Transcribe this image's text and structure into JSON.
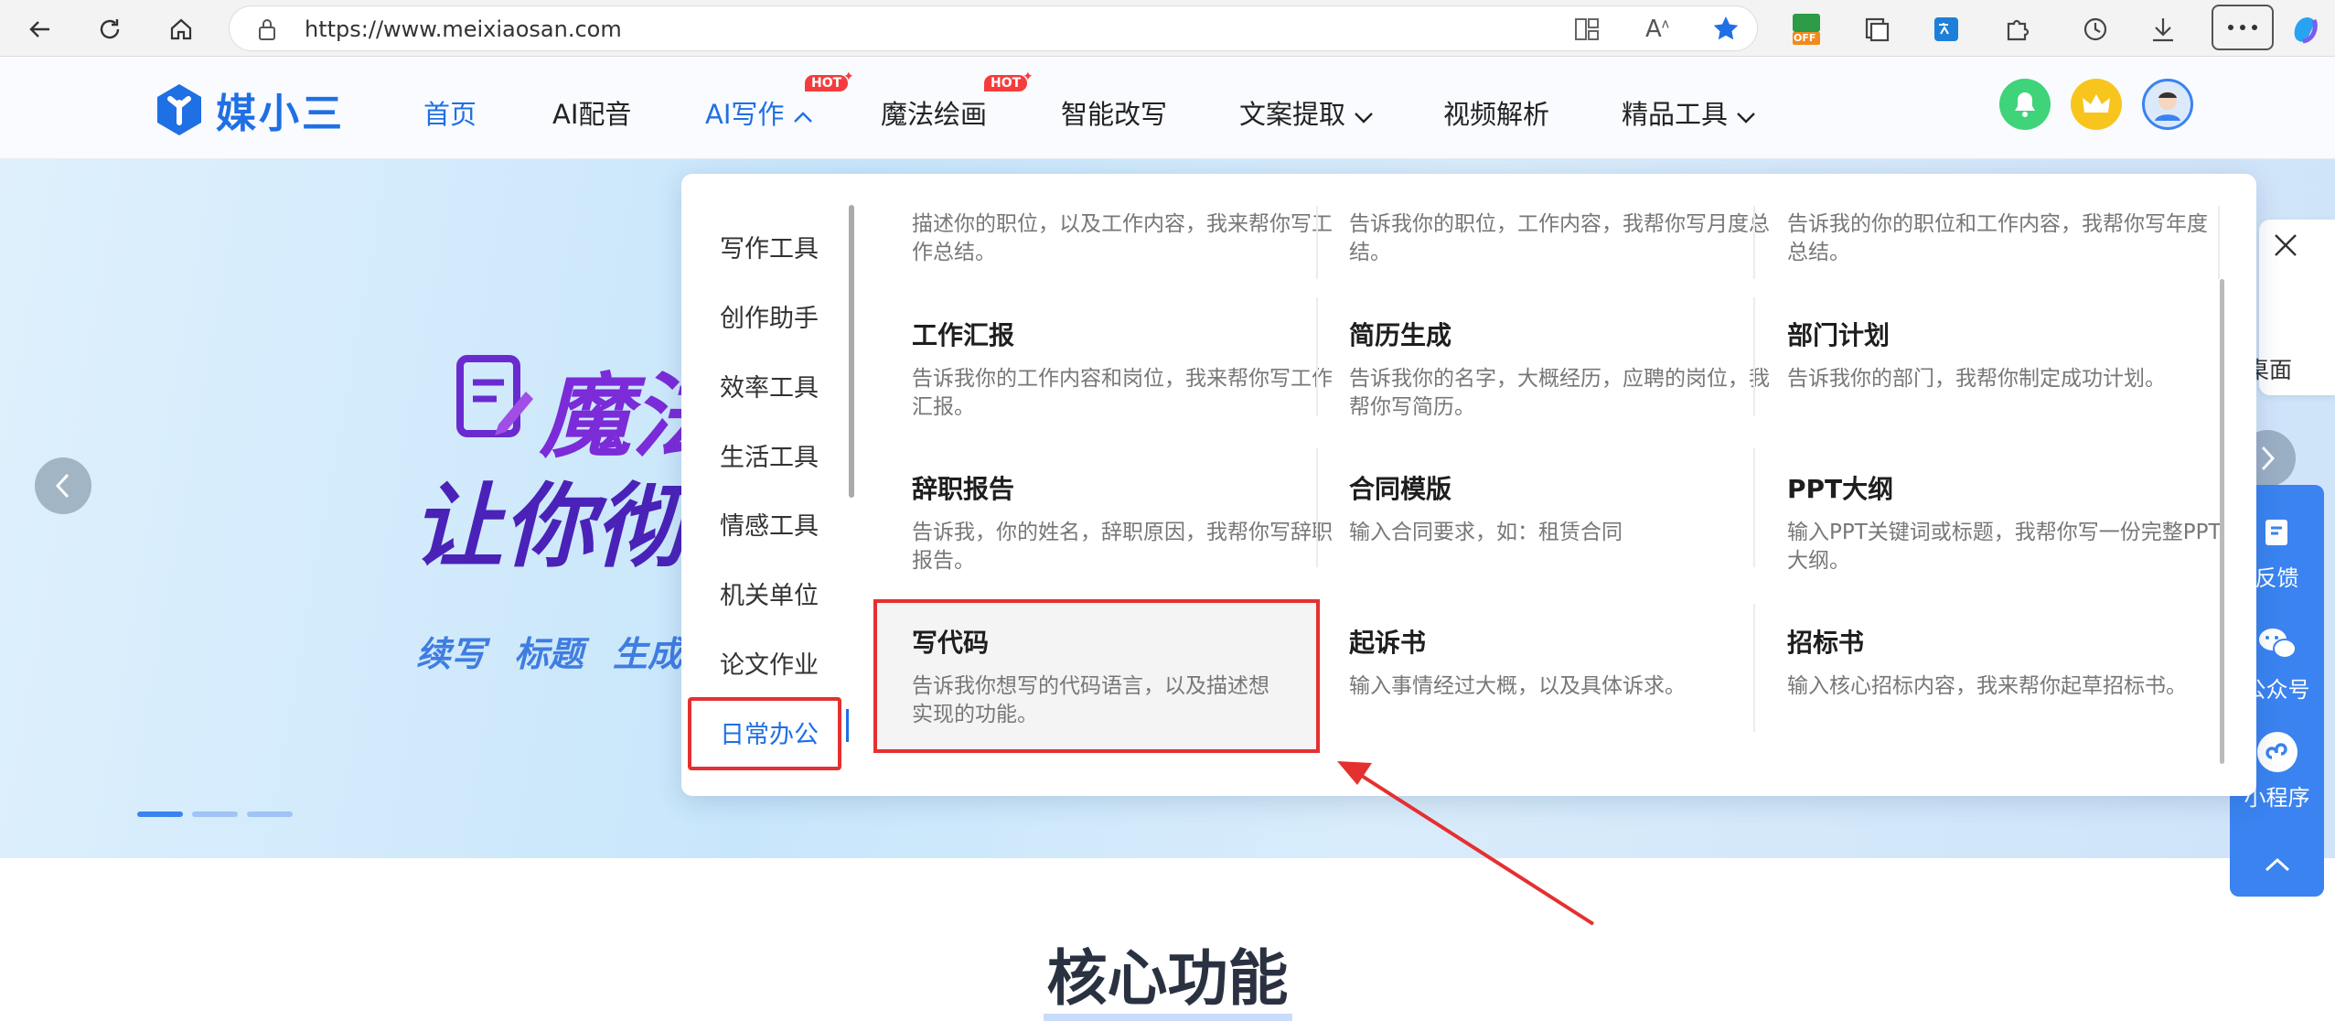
{
  "browser": {
    "url": "https://www.meixiaosan.com",
    "ext_off_badge": "OFF"
  },
  "header": {
    "logo_text": "媒小三",
    "nav": [
      {
        "label": "首页"
      },
      {
        "label": "AI配音"
      },
      {
        "label": "AI写作"
      },
      {
        "label": "魔法绘画"
      },
      {
        "label": "智能改写"
      },
      {
        "label": "文案提取"
      },
      {
        "label": "视频解析"
      },
      {
        "label": "精品工具"
      }
    ],
    "hot_badge": "HOT"
  },
  "hero": {
    "title_line1": "魔法",
    "title_line2": "让你彻底",
    "tags": [
      "续写",
      "标题",
      "生成"
    ]
  },
  "dropdown": {
    "categories": [
      "写作工具",
      "创作助手",
      "效率工具",
      "生活工具",
      "情感工具",
      "机关单位",
      "论文作业",
      "日常办公"
    ],
    "active_category": "日常办公",
    "top_row": [
      {
        "desc": "描述你的职位，以及工作内容，我来帮你写工作总结。"
      },
      {
        "desc": "告诉我你的职位，工作内容，我帮你写月度总结。"
      },
      {
        "desc": "告诉我的你的职位和工作内容，我帮你写年度总结。"
      }
    ],
    "cards": [
      {
        "title": "工作汇报",
        "desc": "告诉我你的工作内容和岗位，我来帮你写工作汇报。"
      },
      {
        "title": "简历生成",
        "desc": "告诉我你的名字，大概经历，应聘的岗位，我帮你写简历。"
      },
      {
        "title": "部门计划",
        "desc": "告诉我你的部门，我帮你制定成功计划。"
      },
      {
        "title": "辞职报告",
        "desc": "告诉我，你的姓名，辞职原因，我帮你写辞职报告。"
      },
      {
        "title": "合同模版",
        "desc": "输入合同要求，如：租赁合同"
      },
      {
        "title": "PPT大纲",
        "desc": "输入PPT关键词或标题，我帮你写一份完整PPT大纲。"
      },
      {
        "title": "写代码",
        "desc": "告诉我你想写的代码语言，以及描述想实现的功能。"
      },
      {
        "title": "起诉书",
        "desc": "输入事情经过大概，以及具体诉求。"
      },
      {
        "title": "招标书",
        "desc": "输入核心招标内容，我来帮你起草招标书。"
      }
    ]
  },
  "side_widget": {
    "label": "桌面"
  },
  "float_bar": {
    "items": [
      {
        "label": "反馈"
      },
      {
        "label": "公众号"
      },
      {
        "label": "小程序"
      }
    ]
  },
  "section": {
    "title": "核心功能"
  },
  "colors": {
    "brand": "#1f6fe5",
    "highlight": "#e53030",
    "float": "#3a83f0"
  }
}
